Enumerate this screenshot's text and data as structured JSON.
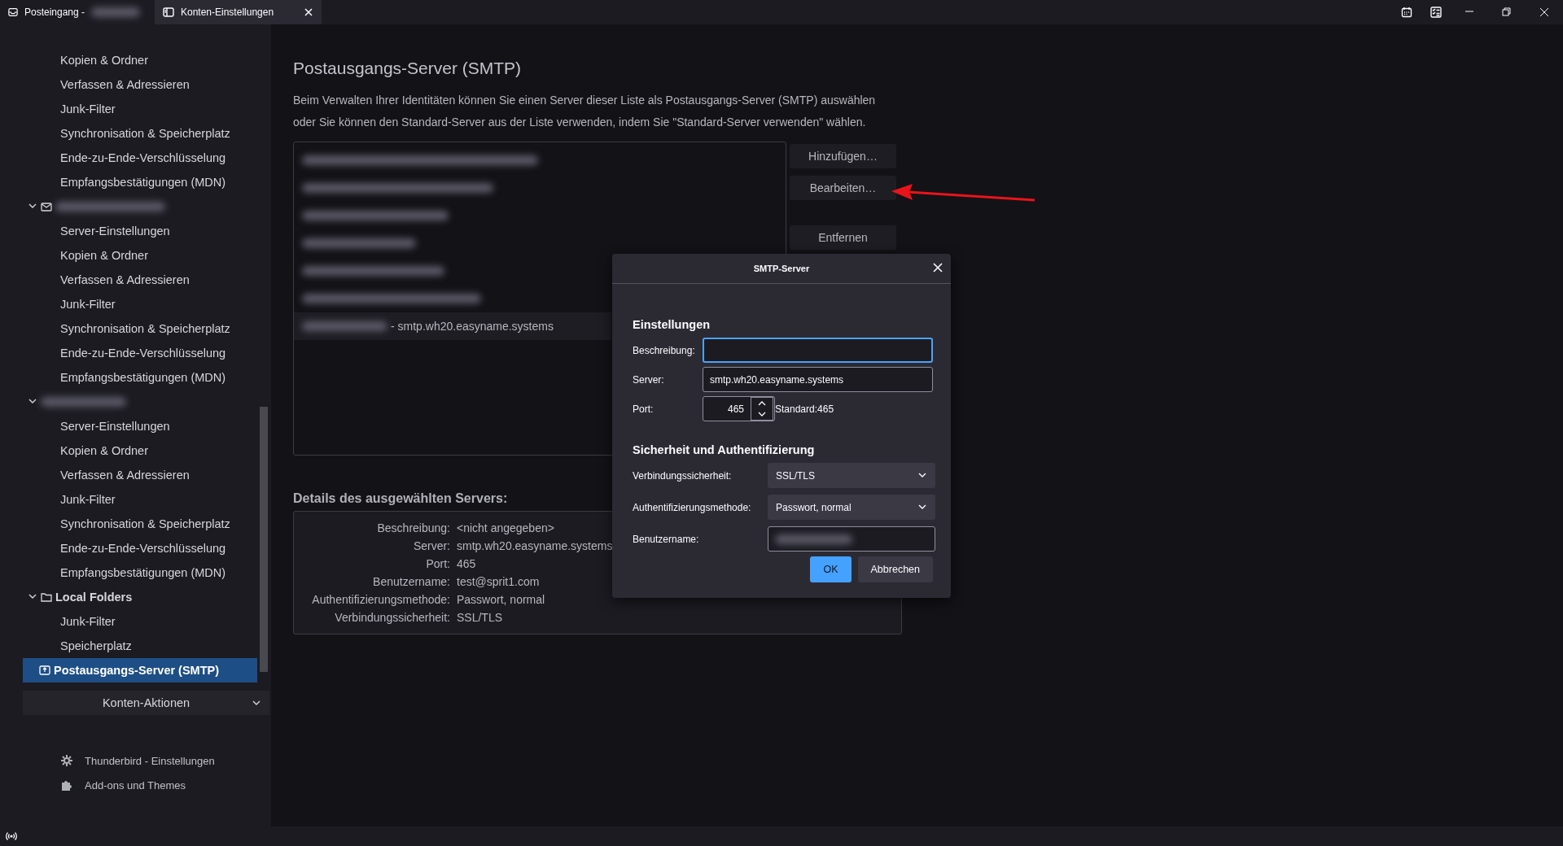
{
  "tabs": [
    {
      "kind": "inbox",
      "label": "Posteingang - ",
      "blurred_suffix": true,
      "selected": false,
      "closable": false
    },
    {
      "kind": "settings",
      "label": "Konten-Einstellungen",
      "selected": true,
      "closable": true
    }
  ],
  "sidebar": {
    "accounts": [
      {
        "children": [
          {
            "label": "Kopien & Ordner",
            "selected": false
          },
          {
            "label": "Verfassen & Adressieren",
            "selected": false
          },
          {
            "label": "Junk-Filter",
            "selected": false
          },
          {
            "label": "Synchronisation & Speicherplatz",
            "selected": false
          },
          {
            "label": "Ende-zu-Ende-Verschlüsselung",
            "selected": false
          },
          {
            "label": "Empfangsbestätigungen (MDN)",
            "selected": false
          }
        ]
      },
      {
        "kind": "mail",
        "blurred": true,
        "expanded": true,
        "children": [
          {
            "label": "Server-Einstellungen",
            "selected": false
          },
          {
            "label": "Kopien & Ordner",
            "selected": false
          },
          {
            "label": "Verfassen & Adressieren",
            "selected": false
          },
          {
            "label": "Junk-Filter",
            "selected": false
          },
          {
            "label": "Synchronisation & Speicherplatz",
            "selected": false
          },
          {
            "label": "Ende-zu-Ende-Verschlüsselung",
            "selected": false
          },
          {
            "label": "Empfangsbestätigungen (MDN)",
            "selected": false
          }
        ]
      },
      {
        "kind": "plain",
        "blurred": true,
        "expanded": true,
        "children": [
          {
            "label": "Server-Einstellungen",
            "selected": false
          },
          {
            "label": "Kopien & Ordner",
            "selected": false
          },
          {
            "label": "Verfassen & Adressieren",
            "selected": false
          },
          {
            "label": "Junk-Filter",
            "selected": false
          },
          {
            "label": "Synchronisation & Speicherplatz",
            "selected": false
          },
          {
            "label": "Ende-zu-Ende-Verschlüsselung",
            "selected": false
          },
          {
            "label": "Empfangsbestätigungen (MDN)",
            "selected": false
          }
        ]
      },
      {
        "kind": "folder",
        "label": "Local Folders",
        "expanded": true,
        "children": [
          {
            "label": "Junk-Filter",
            "selected": false
          },
          {
            "label": "Speicherplatz",
            "selected": false
          }
        ]
      },
      {
        "kind": "outbox",
        "label": "Postausgangs-Server (SMTP)",
        "selected": true
      }
    ],
    "actions_button": "Konten-Aktionen",
    "footer": [
      {
        "kind": "gear",
        "label": "Thunderbird - Einstellungen"
      },
      {
        "kind": "puzzle",
        "label": "Add-ons und Themes"
      }
    ]
  },
  "main": {
    "title": "Postausgangs-Server (SMTP)",
    "description": "Beim Verwalten Ihrer Identitäten können Sie einen Server dieser Liste als Postausgangs-Server (SMTP) auswählen oder Sie können den Standard-Server aus der Liste verwenden, indem Sie \"Standard-Server verwenden\" wählen.",
    "servers": [
      {
        "blurred": true,
        "selected": false
      },
      {
        "blurred": true,
        "selected": false
      },
      {
        "blurred": true,
        "selected": false
      },
      {
        "blurred": true,
        "selected": false
      },
      {
        "blurred": true,
        "selected": false
      },
      {
        "blurred": true,
        "selected": false
      },
      {
        "blurred": true,
        "text": "- smtp.wh20.easyname.systems",
        "selected": true
      }
    ],
    "buttons": [
      "Hinzufügen…",
      "Bearbeiten…",
      "Entfernen"
    ],
    "details_title": "Details des ausgewählten Servers:",
    "details": [
      {
        "label": "Beschreibung:",
        "value": "<nicht angegeben>"
      },
      {
        "label": "Server:",
        "value": "smtp.wh20.easyname.systems"
      },
      {
        "label": "Port:",
        "value": "465"
      },
      {
        "label": "Benutzername:",
        "value": "test@sprit1.com"
      },
      {
        "label": "Authentifizierungsmethode:",
        "value": "Passwort, normal"
      },
      {
        "label": "Verbindungssicherheit:",
        "value": "SSL/TLS"
      }
    ]
  },
  "dialog": {
    "title": "SMTP-Server",
    "section_1": "Einstellungen",
    "fields": [
      {
        "label": "Beschreibung:",
        "focused": true
      },
      {
        "label": "Server:",
        "value": "smtp.wh20.easyname.systems",
        "focused": false
      }
    ],
    "port": {
      "label": "Port:",
      "value": "465",
      "default_text": "Standard:465"
    },
    "section_2": "Sicherheit und Authentifizierung",
    "rows": [
      {
        "kind": "select",
        "label": "Verbindungssicherheit:",
        "value": "SSL/TLS"
      },
      {
        "kind": "select",
        "label": "Authentifizierungsmethode:",
        "value": "Passwort, normal"
      },
      {
        "kind": "blurred-input",
        "label": "Benutzername:"
      }
    ],
    "buttons": [
      {
        "label": "OK",
        "primary": true
      },
      {
        "label": "Abbrechen",
        "primary": false
      }
    ]
  }
}
